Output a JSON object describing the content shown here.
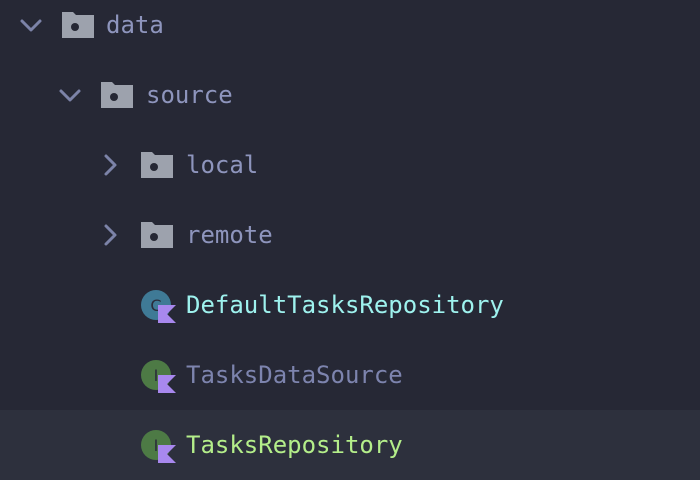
{
  "tree": {
    "items": [
      {
        "label": "data",
        "kind": "folder",
        "state": "expanded"
      },
      {
        "label": "source",
        "kind": "folder",
        "state": "expanded"
      },
      {
        "label": "local",
        "kind": "folder",
        "state": "collapsed"
      },
      {
        "label": "remote",
        "kind": "folder",
        "state": "collapsed"
      },
      {
        "label": "DefaultTasksRepository",
        "kind": "kotlin-class",
        "icon_letter": "C"
      },
      {
        "label": "TasksDataSource",
        "kind": "kotlin-interface",
        "icon_letter": "I"
      },
      {
        "label": "TasksRepository",
        "kind": "kotlin-interface",
        "icon_letter": "I",
        "selected": true
      }
    ]
  },
  "colors": {
    "background": "#262835",
    "selected_row": "#2d303d",
    "folder_label": "#8e95bd",
    "folder_icon": "#9da2ad",
    "chevron": "#7c83a8",
    "class_badge": "#3f7a96",
    "interface_badge": "#4d7a45",
    "kotlin_mark": "#a888ee",
    "class_label": "#9ef2ee",
    "interface_label": "#7d84ae",
    "modified_label": "#b4ee8a"
  }
}
